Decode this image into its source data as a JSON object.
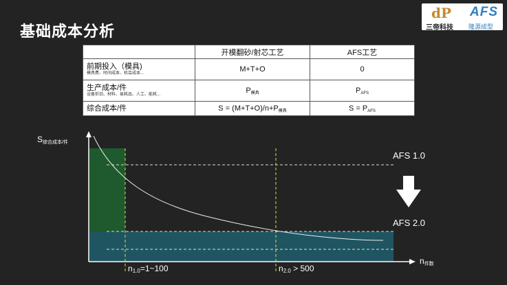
{
  "title": "基础成本分析",
  "logos": {
    "sandi_mark": "dP",
    "sandi_name": "三帝科技",
    "afs_mark": "AFS",
    "afs_name": "隆源成型"
  },
  "table": {
    "headers": [
      "",
      "开模翻砂/射芯工艺",
      "AFS工艺"
    ],
    "rows": [
      {
        "label": "前期投入（模具)",
        "sublabel": "模具费、时间成本、机会成本...",
        "traditional": "M+T+O",
        "afs": "0"
      },
      {
        "label": "生产成本/件",
        "sublabel": "设备折旧、材料、易耗品、人工、能耗...",
        "traditional_base": "P",
        "traditional_sub": "模具",
        "afs_base": "P",
        "afs_sub": "AFS"
      },
      {
        "label": "综合成本/件",
        "traditional_base": "S = (M+T+O)/n+P",
        "traditional_sub": "模具",
        "afs_base": "S = P",
        "afs_sub": "AFS"
      }
    ]
  },
  "chart": {
    "y_axis_base": "S",
    "y_axis_sub": "综合成本/件",
    "x_axis_base": "n",
    "x_axis_sub": "件数",
    "afs_v1_label": "AFS 1.0",
    "afs_v2_label": "AFS 2.0",
    "n1_base": "n",
    "n1_sub": "1.0",
    "n1_value": "=1~100",
    "n2_base": "n",
    "n2_sub": "2.0",
    "n2_value": " > 500",
    "colors": {
      "green_fill": "#1f5a2e",
      "teal_fill": "#1f5561",
      "guide_yellow": "#e8d84a",
      "axis": "#ffffff",
      "arrow": "#ffffff"
    }
  }
}
